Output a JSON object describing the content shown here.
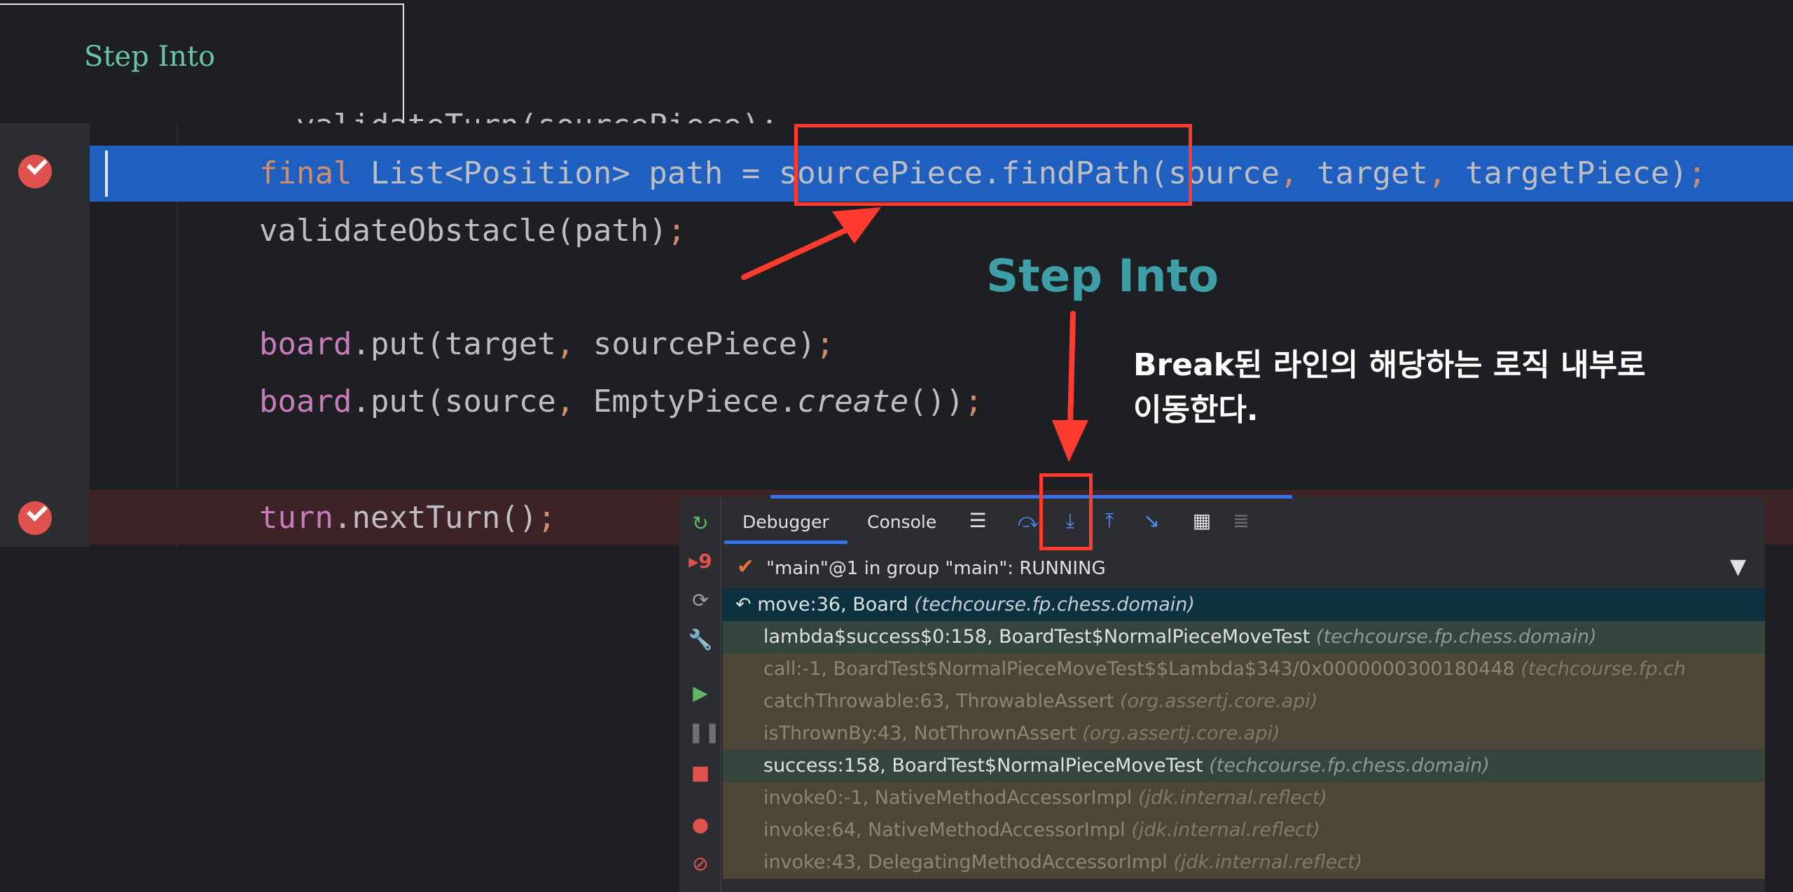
{
  "slide_title": "Step Into",
  "code": {
    "line_top_partial": "validateTurn(sourcePiece);",
    "line1": {
      "kw": "final",
      "type": " List<Position> path = ",
      "call": "sourcePiece.findPath",
      "args_open": "(source",
      "c1": ",",
      "a2": " target",
      "c2": ",",
      "a3": " targetPiece)",
      "semi": ";"
    },
    "line2": {
      "text": "validateObstacle(path)",
      "semi": ";"
    },
    "line3": {
      "obj": "board",
      "text": ".put(target",
      "comma": ",",
      "rest": " sourcePiece)",
      "semi": ";"
    },
    "line4": {
      "obj": "board",
      "text": ".put(source",
      "comma": ",",
      "rest1": " EmptyPiece.",
      "create": "create",
      "rest2": "())",
      "semi": ";"
    },
    "line5": {
      "obj": "turn",
      "text": ".nextTurn()",
      "semi": ";"
    }
  },
  "caption": {
    "step_into": "Step Into",
    "explain_line1": "Break된 라인의 해당하는 로직 내부로",
    "explain_line2": "이동한다."
  },
  "debugger": {
    "tabs": {
      "debugger": "Debugger",
      "console": "Console"
    },
    "thread_status": "\"main\"@1 in group \"main\": RUNNING",
    "frames": [
      {
        "method": "move:36, Board",
        "pkg": "(techcourse.fp.chess.domain)",
        "style": "selected"
      },
      {
        "method": "lambda$success$0:158, BoardTest$NormalPieceMoveTest",
        "pkg": "(techcourse.fp.chess.domain)",
        "style": "project"
      },
      {
        "method": "call:-1, BoardTest$NormalPieceMoveTest$$Lambda$343/0x0000000300180448",
        "pkg": "(techcourse.fp.ch",
        "style": "library"
      },
      {
        "method": "catchThrowable:63, ThrowableAssert",
        "pkg": "(org.assertj.core.api)",
        "style": "library"
      },
      {
        "method": "isThrownBy:43, NotThrownAssert",
        "pkg": "(org.assertj.core.api)",
        "style": "library"
      },
      {
        "method": "success:158, BoardTest$NormalPieceMoveTest",
        "pkg": "(techcourse.fp.chess.domain)",
        "style": "project"
      },
      {
        "method": "invoke0:-1, NativeMethodAccessorImpl",
        "pkg": "(jdk.internal.reflect)",
        "style": "library"
      },
      {
        "method": "invoke:64, NativeMethodAccessorImpl",
        "pkg": "(jdk.internal.reflect)",
        "style": "library"
      },
      {
        "method": "invoke:43, DelegatingMethodAccessorImpl",
        "pkg": "(jdk.internal.reflect)",
        "style": "library"
      }
    ]
  },
  "colors": {
    "accent": "#3574f0",
    "annotation_red": "#ff3b30",
    "caption_teal": "#3f9fa6",
    "breakpoint": "#e0524e"
  },
  "icons": [
    "rerun-icon",
    "breakpoint-badge-icon",
    "restore-layout-icon",
    "wrench-icon",
    "resume-icon",
    "pause-icon",
    "stop-icon",
    "view-breakpoints-icon",
    "mute-breakpoints-icon",
    "menu-icon",
    "step-over-icon",
    "step-into-icon",
    "step-out-icon",
    "run-to-cursor-icon",
    "evaluate-icon",
    "trace-icon",
    "filter-icon",
    "return-arrow-icon",
    "check-icon"
  ]
}
